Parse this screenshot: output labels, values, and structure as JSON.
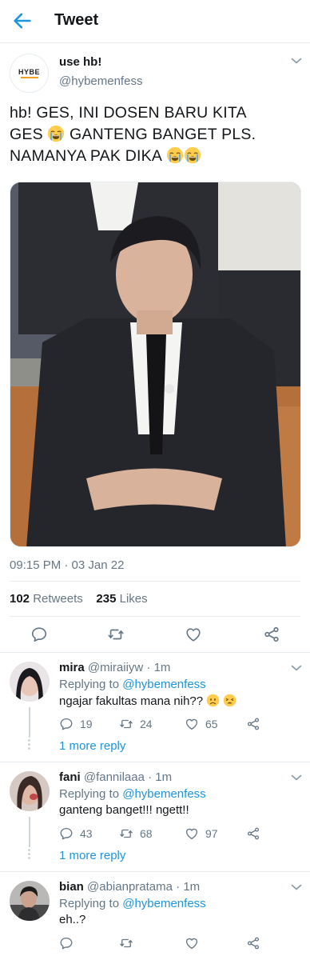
{
  "header": {
    "title": "Tweet",
    "back_icon": "arrow-left-icon"
  },
  "tweet": {
    "display_name": "use hb!",
    "handle": "@hybemenfess",
    "avatar_logo_text": "HYBE",
    "text_lines": [
      "hb! GES, INI DOSEN BARU KITA",
      "GES",
      "GANTENG BANGET PLS.",
      "NAMANYA PAK DIKA"
    ],
    "emoji": "loudly-crying-face",
    "timestamp": "09:15 PM · 03 Jan 22",
    "retweets_count": "102",
    "retweets_label": "Retweets",
    "likes_count": "235",
    "likes_label": "Likes"
  },
  "replies": [
    {
      "name": "mira",
      "handle": "@miraiiyw",
      "time": "· 1m",
      "replying_prefix": "Replying to",
      "replying_to": "@hybemenfess",
      "text": "ngajar fakultas mana nih??",
      "emoji": [
        "worried-face",
        "weary-face"
      ],
      "reply_count": "19",
      "retweet_count": "24",
      "like_count": "65",
      "more_reply": "1 more reply"
    },
    {
      "name": "fani",
      "handle": "@fannilaaa",
      "time": "· 1m",
      "replying_prefix": "Replying to",
      "replying_to": "@hybemenfess",
      "text": "ganteng banget!!! ngett!!",
      "reply_count": "43",
      "retweet_count": "68",
      "like_count": "97",
      "more_reply": "1 more reply"
    },
    {
      "name": "bian",
      "handle": "@abianpratama",
      "time": "· 1m",
      "replying_prefix": "Replying to",
      "replying_to": "@hybemenfess",
      "text": "eh..?",
      "reply_count": "",
      "retweet_count": "",
      "like_count": ""
    }
  ],
  "colors": {
    "accent": "#1b95e0",
    "secondary_text": "#657786",
    "border": "#e6ecf0"
  }
}
